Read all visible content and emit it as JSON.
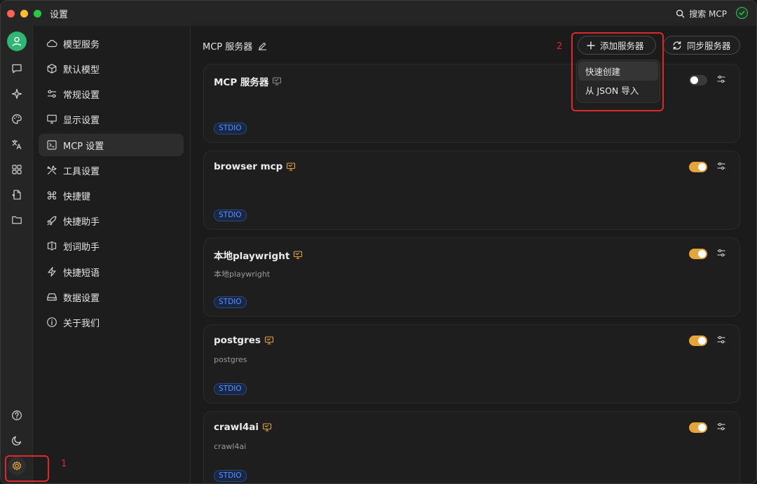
{
  "window": {
    "title": "设置",
    "search_label": "搜索 MCP"
  },
  "rail": {
    "items": [
      "user-avatar",
      "chat-icon",
      "sparkle-icon",
      "palette-icon",
      "translate-icon",
      "apps-icon",
      "document-icon",
      "folder-icon",
      "help-icon",
      "moon-icon",
      "settings-icon"
    ]
  },
  "nav": {
    "items": [
      {
        "label": "模型服务",
        "icon": "cloud-icon"
      },
      {
        "label": "默认模型",
        "icon": "cube-icon"
      },
      {
        "label": "常规设置",
        "icon": "sliders-icon"
      },
      {
        "label": "显示设置",
        "icon": "monitor-icon"
      },
      {
        "label": "MCP 设置",
        "icon": "terminal-icon"
      },
      {
        "label": "工具设置",
        "icon": "tools-icon"
      },
      {
        "label": "快捷键",
        "icon": "command-icon"
      },
      {
        "label": "快捷助手",
        "icon": "rocket-icon"
      },
      {
        "label": "划词助手",
        "icon": "text-cursor-icon"
      },
      {
        "label": "快捷短语",
        "icon": "zap-icon"
      },
      {
        "label": "数据设置",
        "icon": "drive-icon"
      },
      {
        "label": "关于我们",
        "icon": "info-icon"
      }
    ],
    "active": "MCP 设置"
  },
  "main": {
    "title": "MCP 服务器",
    "add_button": "添加服务器",
    "sync_button": "同步服务器",
    "dropdown": [
      "快速创建",
      "从 JSON 导入"
    ]
  },
  "servers": [
    {
      "name": "MCP 服务器",
      "description": "",
      "tag": "STDIO",
      "enabled": false,
      "icon_color": "#8a8a8a"
    },
    {
      "name": "browser mcp",
      "description": "",
      "tag": "STDIO",
      "enabled": true,
      "icon_color": "#e5a53a"
    },
    {
      "name": "本地playwright",
      "description": "本地playwright",
      "tag": "STDIO",
      "enabled": true,
      "icon_color": "#e5a53a"
    },
    {
      "name": "postgres",
      "description": "postgres",
      "tag": "STDIO",
      "enabled": true,
      "icon_color": "#e5a53a"
    },
    {
      "name": "crawl4ai",
      "description": "crawl4ai",
      "tag": "STDIO",
      "enabled": true,
      "icon_color": "#e5a53a"
    }
  ],
  "annotations": {
    "n1": "1",
    "n2": "2"
  },
  "colors": {
    "accent": "#e5a53a",
    "annotation": "#e0282a",
    "tag": "#5f91ff",
    "avatar": "#2fb672"
  }
}
